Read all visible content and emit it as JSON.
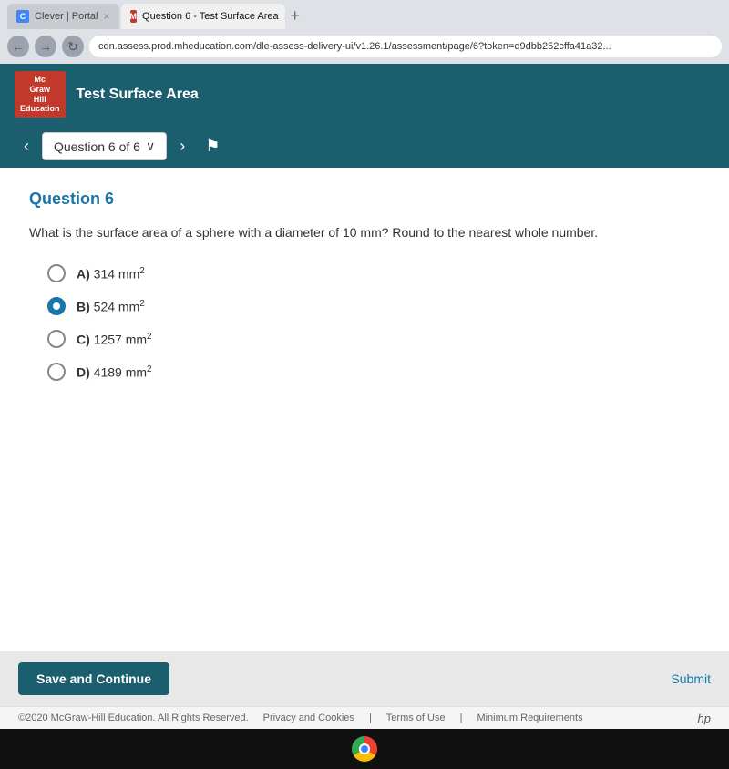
{
  "browser": {
    "tabs": [
      {
        "id": "tab1",
        "label": "Clever | Portal",
        "active": false,
        "favicon": "C"
      },
      {
        "id": "tab2",
        "label": "Question 6 - Test Surface Area",
        "active": true,
        "favicon": "M"
      }
    ],
    "address_bar": "cdn.assess.prod.mheducation.com/dle-assess-delivery-ui/v1.26.1/assessment/page/6?token=d9dbb252cffa41a32..."
  },
  "header": {
    "logo_line1": "Mc",
    "logo_line2": "Graw",
    "logo_line3": "Hill",
    "logo_line4": "Education",
    "title": "Test Surface Area"
  },
  "question_nav": {
    "prev_label": "‹",
    "next_label": "›",
    "selector_label": "Question 6 of 6",
    "dropdown_icon": "∨"
  },
  "question": {
    "number": "Question 6",
    "text": "What is the surface area of a sphere with a diameter of 10 mm? Round to the nearest whole number.",
    "options": [
      {
        "id": "A",
        "label": "A)",
        "value": "314 mm",
        "sup": "2",
        "selected": false
      },
      {
        "id": "B",
        "label": "B)",
        "value": "524 mm",
        "sup": "2",
        "selected": true
      },
      {
        "id": "C",
        "label": "C)",
        "value": "1257 mm",
        "sup": "2",
        "selected": false
      },
      {
        "id": "D",
        "label": "D)",
        "value": "4189 mm",
        "sup": "2",
        "selected": false
      }
    ]
  },
  "footer": {
    "save_button_label": "Save and Continue",
    "submit_label": "Submit"
  },
  "copyright": {
    "text": "©2020 McGraw-Hill Education. All Rights Reserved.",
    "links": [
      "Privacy and Cookies",
      "Terms of Use",
      "Minimum Requirements"
    ]
  }
}
